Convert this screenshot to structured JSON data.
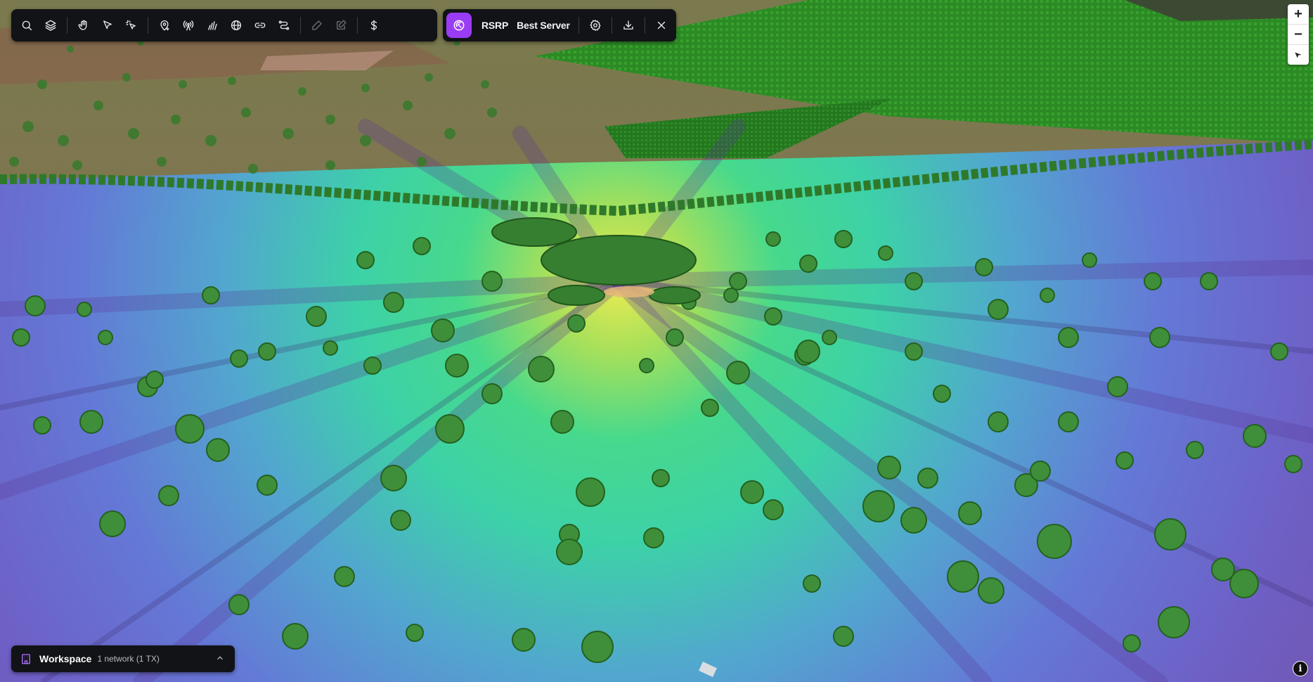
{
  "toolbar": {
    "tools": [
      {
        "name": "search-button",
        "icon": "search-icon"
      },
      {
        "name": "layers-button",
        "icon": "layers-icon"
      },
      {
        "name": "pan-button",
        "icon": "hand-icon"
      },
      {
        "name": "select-button",
        "icon": "pointer-icon"
      },
      {
        "name": "multi-select-button",
        "icon": "pointer-sparkle-icon"
      },
      {
        "name": "add-site-button",
        "icon": "map-pin-add-icon"
      },
      {
        "name": "antenna-button",
        "icon": "antenna-icon"
      },
      {
        "name": "signal-bars-button",
        "icon": "signal-icon"
      },
      {
        "name": "globe-button",
        "icon": "globe-icon"
      },
      {
        "name": "link-button",
        "icon": "link-icon"
      },
      {
        "name": "route-button",
        "icon": "route-icon"
      },
      {
        "name": "draw-button",
        "icon": "pencil-icon",
        "disabled": true
      },
      {
        "name": "edit-button",
        "icon": "edit-square-icon",
        "disabled": true
      },
      {
        "name": "cost-button",
        "icon": "dollar-icon"
      }
    ]
  },
  "coverage": {
    "active_icon": "coverage-signal-icon",
    "metric_label": "RSRP",
    "mode_label": "Best Server",
    "settings_icon": "gear-icon",
    "download_icon": "download-icon",
    "close_icon": "close-icon"
  },
  "zoom": {
    "zoom_in": "+",
    "zoom_out": "−",
    "reset_icon": "compass-icon"
  },
  "workspace": {
    "title": "Workspace",
    "subtitle": "1 network (1 TX)",
    "icon": "building-icon",
    "toggle_icon": "chevron-up-icon"
  },
  "info": {
    "label": "i"
  },
  "colors": {
    "toolbar_bg": "#111317",
    "accent": "#9b3cf5",
    "coverage_strong": "#e4e94a",
    "coverage_mid": "#2fd49a",
    "coverage_weak": "#6a78d8",
    "field_green": "#2f8a2a",
    "tree_green": "#3f8f3a"
  }
}
